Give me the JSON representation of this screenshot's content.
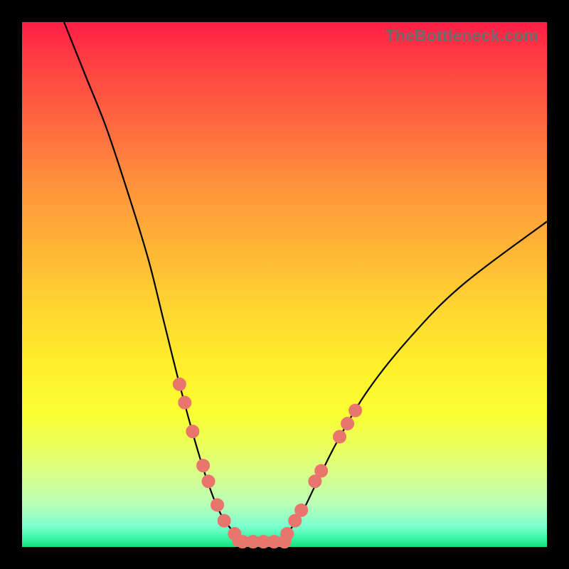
{
  "watermark": "TheBottleneck.com",
  "colors": {
    "frame": "#000000",
    "marker": "#e9766d",
    "line": "#000000",
    "gradient_top": "#ff1e46",
    "gradient_bottom": "#15e07c"
  },
  "chart_data": {
    "type": "line",
    "title": "",
    "xlabel": "",
    "ylabel": "",
    "xlim": [
      0,
      100
    ],
    "ylim": [
      0,
      100
    ],
    "curve": {
      "left": [
        {
          "x": 8.0,
          "y": 100.0
        },
        {
          "x": 12.0,
          "y": 90.0
        },
        {
          "x": 16.0,
          "y": 80.0
        },
        {
          "x": 20.0,
          "y": 68.0
        },
        {
          "x": 24.0,
          "y": 55.0
        },
        {
          "x": 27.0,
          "y": 43.0
        },
        {
          "x": 30.0,
          "y": 31.0
        },
        {
          "x": 33.0,
          "y": 20.0
        },
        {
          "x": 35.5,
          "y": 12.0
        },
        {
          "x": 38.0,
          "y": 6.0
        },
        {
          "x": 41.0,
          "y": 2.0
        }
      ],
      "base": [
        {
          "x": 41.0,
          "y": 1.0
        },
        {
          "x": 50.0,
          "y": 1.0
        }
      ],
      "right": [
        {
          "x": 50.0,
          "y": 2.0
        },
        {
          "x": 53.0,
          "y": 6.0
        },
        {
          "x": 56.0,
          "y": 12.0
        },
        {
          "x": 60.0,
          "y": 20.0
        },
        {
          "x": 66.0,
          "y": 30.0
        },
        {
          "x": 74.0,
          "y": 40.0
        },
        {
          "x": 84.0,
          "y": 50.0
        },
        {
          "x": 100.0,
          "y": 62.0
        }
      ]
    },
    "markers_left": [
      {
        "x": 30.0,
        "y": 31.0
      },
      {
        "x": 31.0,
        "y": 27.5
      },
      {
        "x": 32.5,
        "y": 22.0
      },
      {
        "x": 34.5,
        "y": 15.5
      },
      {
        "x": 35.5,
        "y": 12.5
      },
      {
        "x": 37.2,
        "y": 8.0
      },
      {
        "x": 38.5,
        "y": 5.0
      },
      {
        "x": 40.5,
        "y": 2.5
      }
    ],
    "markers_right": [
      {
        "x": 50.5,
        "y": 2.5
      },
      {
        "x": 52.0,
        "y": 5.0
      },
      {
        "x": 53.2,
        "y": 7.0
      },
      {
        "x": 55.8,
        "y": 12.5
      },
      {
        "x": 57.0,
        "y": 14.5
      },
      {
        "x": 60.5,
        "y": 21.0
      },
      {
        "x": 62.0,
        "y": 23.5
      },
      {
        "x": 63.5,
        "y": 26.0
      }
    ],
    "markers_base": [
      {
        "x": 42.0,
        "y": 1.0
      },
      {
        "x": 44.0,
        "y": 1.0
      },
      {
        "x": 46.0,
        "y": 1.0
      },
      {
        "x": 48.0,
        "y": 1.0
      },
      {
        "x": 50.0,
        "y": 1.0
      }
    ],
    "marker_radius": 9
  }
}
